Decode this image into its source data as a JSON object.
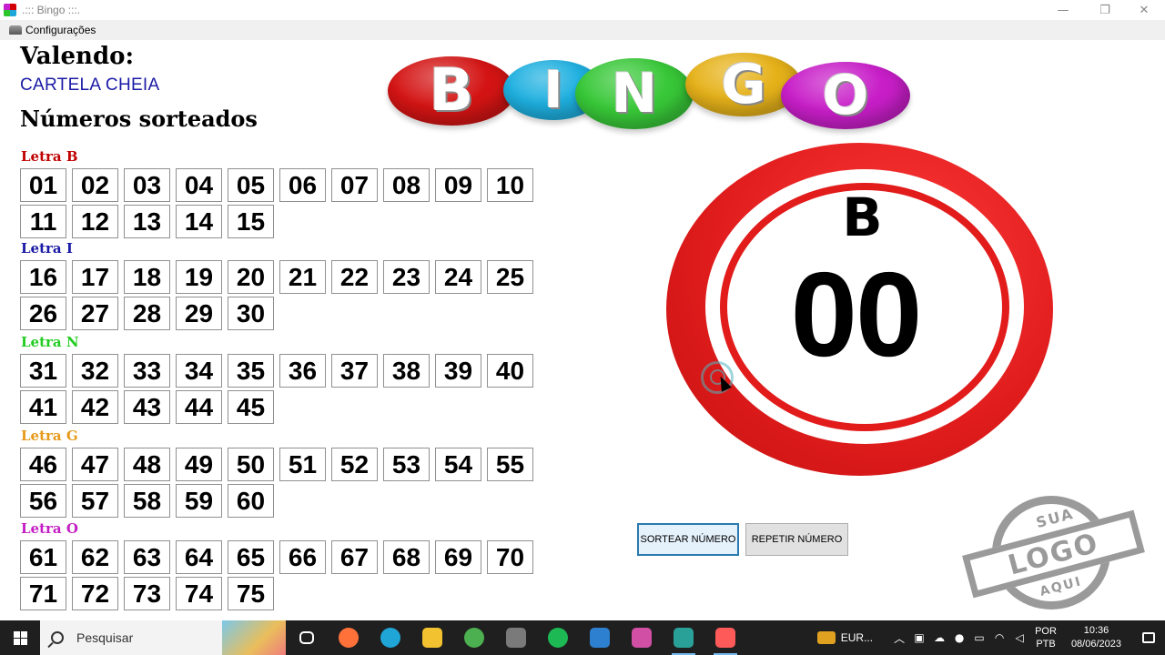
{
  "window": {
    "title": ".::: Bingo :::.",
    "minimize": "—",
    "maximize": "❐",
    "close": "✕"
  },
  "menu": {
    "config_label": "Configurações"
  },
  "valendo": {
    "label": "Valendo:",
    "value": "CARTELA CHEIA"
  },
  "numbers_title": "Números sorteados",
  "groups": [
    {
      "label": "Letra B",
      "color": "#c00000",
      "numbers": [
        "01",
        "02",
        "03",
        "04",
        "05",
        "06",
        "07",
        "08",
        "09",
        "10",
        "11",
        "12",
        "13",
        "14",
        "15"
      ]
    },
    {
      "label": "Letra I",
      "color": "#1a1aa6",
      "numbers": [
        "16",
        "17",
        "18",
        "19",
        "20",
        "21",
        "22",
        "23",
        "24",
        "25",
        "26",
        "27",
        "28",
        "29",
        "30"
      ]
    },
    {
      "label": "Letra N",
      "color": "#22cc22",
      "numbers": [
        "31",
        "32",
        "33",
        "34",
        "35",
        "36",
        "37",
        "38",
        "39",
        "40",
        "41",
        "42",
        "43",
        "44",
        "45"
      ]
    },
    {
      "label": "Letra G",
      "color": "#e69a1a",
      "numbers": [
        "46",
        "47",
        "48",
        "49",
        "50",
        "51",
        "52",
        "53",
        "54",
        "55",
        "56",
        "57",
        "58",
        "59",
        "60"
      ]
    },
    {
      "label": "Letra O",
      "color": "#c41ec4",
      "numbers": [
        "61",
        "62",
        "63",
        "64",
        "65",
        "66",
        "67",
        "68",
        "69",
        "70",
        "71",
        "72",
        "73",
        "74",
        "75"
      ]
    }
  ],
  "logo": {
    "letters": [
      "B",
      "I",
      "N",
      "G",
      "O"
    ],
    "colors": [
      "#d41414",
      "#1eb0e0",
      "#38c838",
      "#e6b21a",
      "#c81ec8"
    ]
  },
  "ball": {
    "letter": "B",
    "number": "00",
    "color": "#e11d1d"
  },
  "buttons": {
    "sortear": "SORTEAR NÚMERO",
    "repetir": "REPETIR NÚMERO"
  },
  "stamp": {
    "top": "SUA",
    "middle": "LOGO",
    "bottom": "AQUI"
  },
  "taskbar": {
    "search_placeholder": "Pesquisar",
    "apps": [
      {
        "name": "task-view-icon",
        "color": "#ffffff"
      },
      {
        "name": "firefox-icon",
        "color": "#ff7139"
      },
      {
        "name": "edge-icon",
        "color": "#1fa5d6"
      },
      {
        "name": "file-explorer-icon",
        "color": "#f2c230"
      },
      {
        "name": "chrome-icon",
        "color": "#4caf50"
      },
      {
        "name": "calculator-icon",
        "color": "#7a7a7a"
      },
      {
        "name": "spotify-icon",
        "color": "#1db954"
      },
      {
        "name": "photos-icon",
        "color": "#2d7fd0"
      },
      {
        "name": "games-icon",
        "color": "#d14fa5"
      },
      {
        "name": "app-icon",
        "color": "#2aa198"
      },
      {
        "name": "bingo-app-icon",
        "color": "#ff5a5a"
      }
    ],
    "tray_eur": "EUR...",
    "lang_top": "POR",
    "lang_bottom": "PTB",
    "time": "10:36",
    "date": "08/06/2023"
  }
}
